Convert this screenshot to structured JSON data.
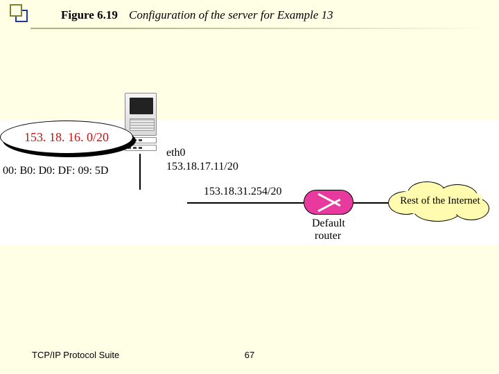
{
  "header": {
    "figure_label": "Figure 6.19",
    "caption": "Configuration of the server for Example 13"
  },
  "diagram": {
    "server_mac": "00: B0: D0: DF: 09: 5D",
    "iface_name": "eth0",
    "iface_ip": "153.18.17.11/20",
    "subnet": "153. 18. 16. 0/20",
    "gateway_ip": "153.18.31.254/20",
    "router_label_1": "Default",
    "router_label_2": "router",
    "cloud_label": "Rest of the Internet"
  },
  "footer": {
    "left": "TCP/IP Protocol Suite",
    "page": "67"
  }
}
